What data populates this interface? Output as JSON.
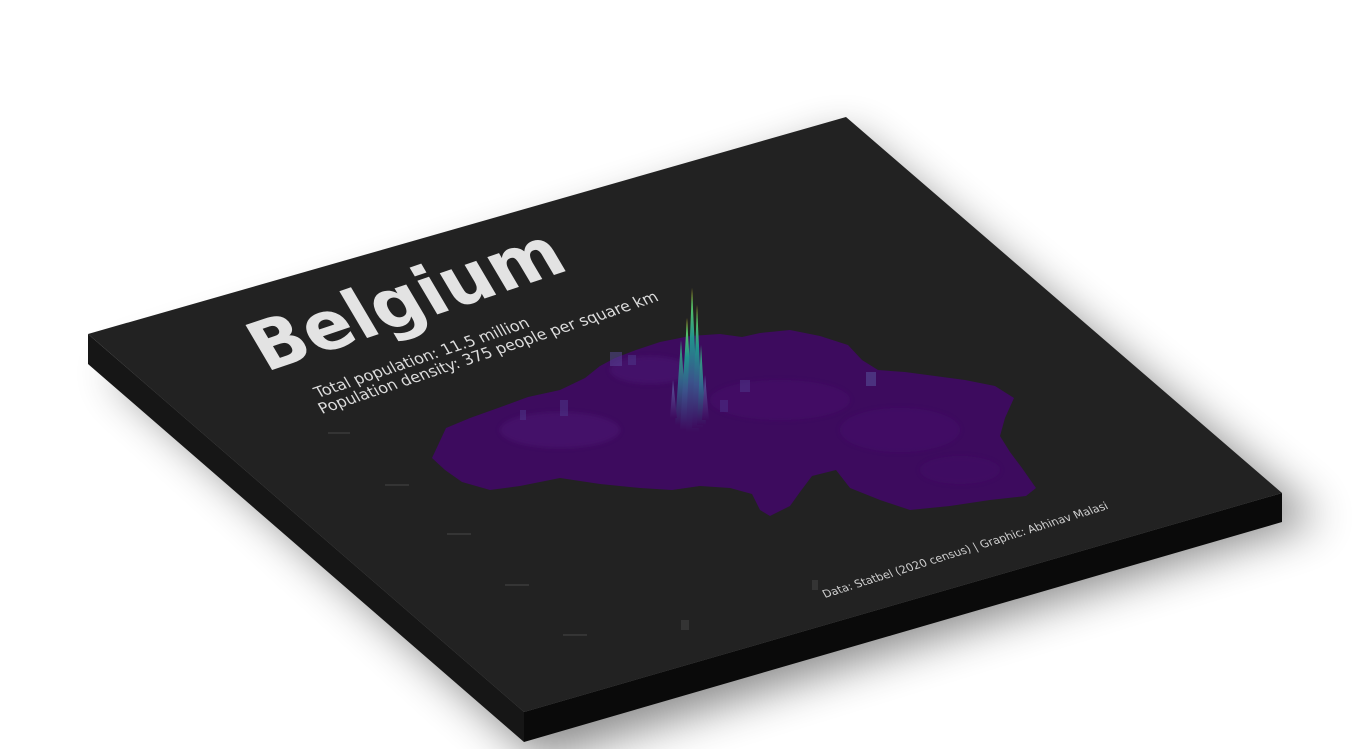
{
  "map": {
    "title": "Belgium",
    "subtitle_line1": "Total population: 11.5 million",
    "subtitle_line2": "Population density: 375 people per square km",
    "caption": "Data: Statbel (2020 census) | Graphic: Abhinav Malasi",
    "region": "Belgium",
    "colors": {
      "board_top": "#222222",
      "board_side_front": "#0a0a0a",
      "board_side_left": "#161616",
      "map_base": "#3d0b5e",
      "map_base_light": "#4b1272",
      "peak_low": "#3b528b",
      "peak_mid": "#21918c",
      "peak_high": "#5ec962",
      "peak_top": "#fde725",
      "title_text": "#e3e3e3",
      "subtitle_text": "#dcdcdc",
      "caption_text": "#cfcfcf"
    }
  }
}
